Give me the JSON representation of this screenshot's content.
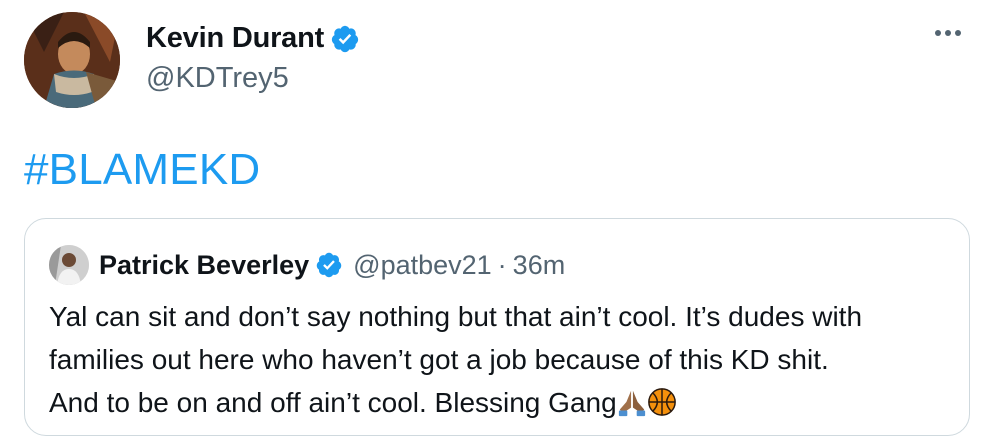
{
  "author": {
    "name": "Kevin Durant",
    "handle": "@KDTrey5",
    "verified_icon": "verified-badge-icon",
    "avatar": "avatar-image"
  },
  "menu": {
    "icon": "more-options-icon"
  },
  "tweet": {
    "text": "#BLAMEKD"
  },
  "quote": {
    "author_name": "Patrick Beverley",
    "author_handle": "@patbev21",
    "separator": "·",
    "time": "36m",
    "lines": [
      "Yal can sit and don’t say nothing but that ain’t cool. It’s dudes with",
      "families out here who haven’t got a job because of this KD shit.",
      "And to be on and off ain’t cool. Blessing Gang"
    ],
    "emojis": [
      "praying-hands-icon",
      "basketball-icon"
    ]
  },
  "colors": {
    "link": "#1d9bf0",
    "secondary_text": "#536471",
    "verified": "#1d9bf0",
    "border": "#cfd9de"
  }
}
